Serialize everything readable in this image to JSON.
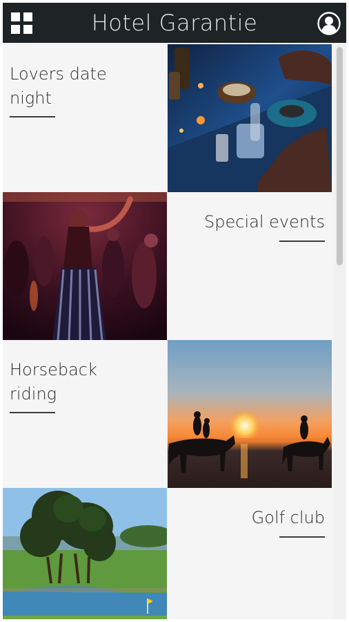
{
  "header": {
    "title": "Hotel Garantie",
    "menu_icon": "grid-menu-icon",
    "profile_icon": "user-profile-icon",
    "background": "#1e2326"
  },
  "tiles": [
    {
      "label": "Lovers date night",
      "photo": "romantic dinner table at night",
      "label_side": "left"
    },
    {
      "label": "Special events",
      "photo": "woman dancing at party",
      "label_side": "right"
    },
    {
      "label": "Horseback riding",
      "photo": "horse riders silhouetted at sunset on beach",
      "label_side": "left"
    },
    {
      "label": "Golf club",
      "photo": "golf course with trees and pond",
      "label_side": "right"
    }
  ]
}
